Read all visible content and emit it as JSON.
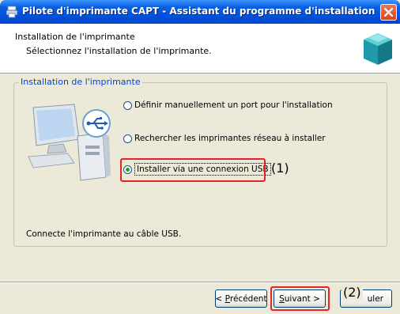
{
  "window": {
    "title": "Pilote d'imprimante CAPT - Assistant du programme d'installation"
  },
  "header": {
    "title": "Installation de l'imprimante",
    "subtitle": "Sélectionnez l'installation de l'imprimante."
  },
  "group": {
    "legend": "Installation de l'imprimante",
    "options": [
      {
        "label": "Définir manuellement un port pour l'installation",
        "checked": false
      },
      {
        "label": "Rechercher les imprimantes réseau à installer",
        "checked": false
      },
      {
        "label": "Installer via une connexion USB",
        "checked": true
      }
    ],
    "status": "Connecte l'imprimante au câble USB."
  },
  "callouts": {
    "one": "(1)",
    "two": "(2)"
  },
  "buttons": {
    "back_prefix": "< ",
    "back_key": "P",
    "back_rest": "récédent",
    "next_key": "S",
    "next_rest": "uivant >",
    "cancel_visible": "uler"
  },
  "colors": {
    "titlebar": "#0054e3",
    "highlight": "#e6222a",
    "legend": "#0046d5",
    "radio_selected": "#21a121"
  },
  "icons": {
    "title": "printer-icon",
    "close": "close-icon",
    "header": "printer-box-icon",
    "illustration": "computer-usb-icon"
  }
}
